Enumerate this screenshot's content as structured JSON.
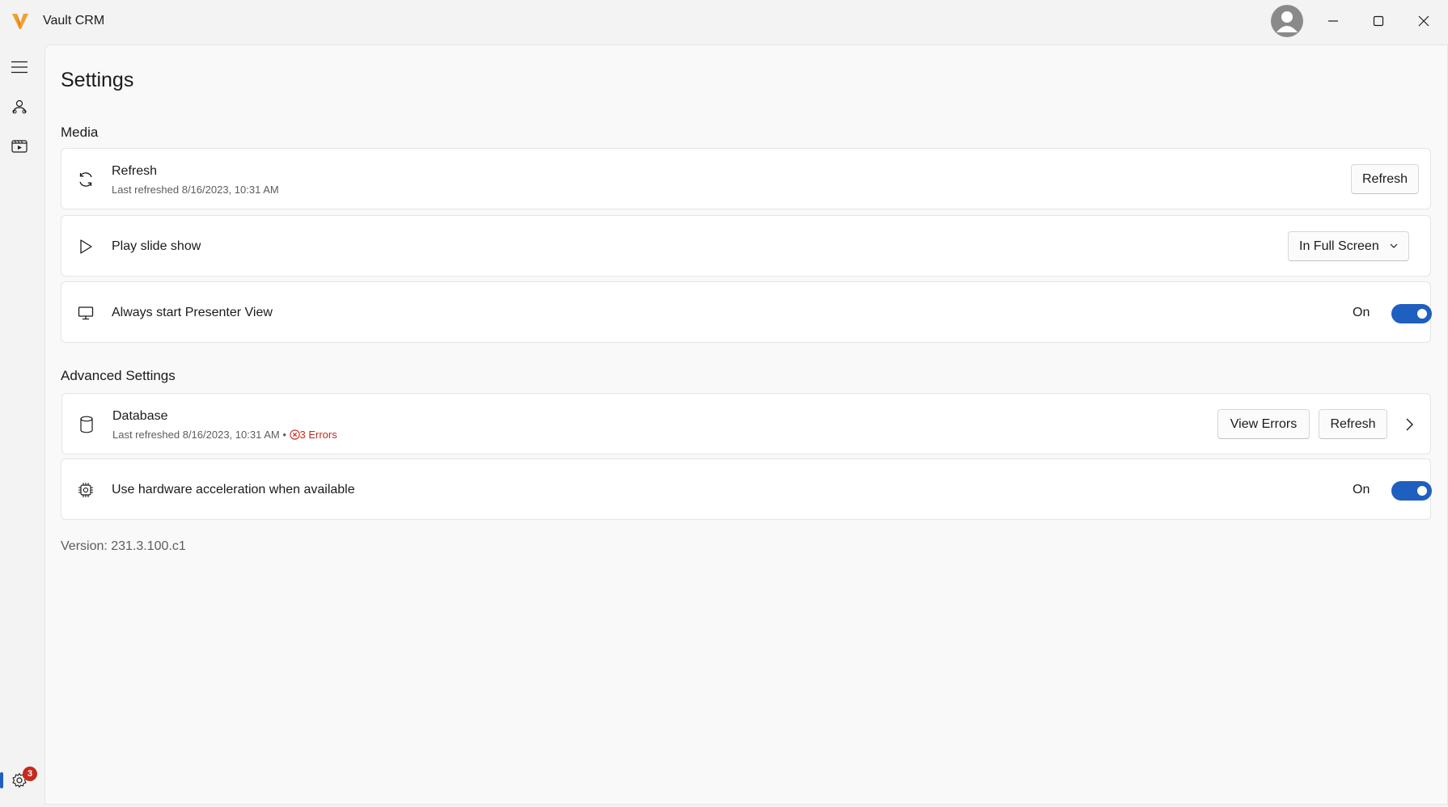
{
  "app": {
    "title": "Vault CRM",
    "brand_color": "#f0a030",
    "accent_color": "#1f5fbf",
    "error_color": "#c42b1c"
  },
  "nav": {
    "items": [
      {
        "name": "menu",
        "icon": "hamburger-icon"
      },
      {
        "name": "accounts",
        "icon": "accounts-icon"
      },
      {
        "name": "media",
        "icon": "media-icon"
      },
      {
        "name": "settings",
        "icon": "gear-icon",
        "active": true
      }
    ],
    "settings_badge": "3"
  },
  "page": {
    "title": "Settings"
  },
  "media": {
    "section_title": "Media",
    "refresh": {
      "title": "Refresh",
      "subtitle": "Last refreshed 8/16/2023, 10:31 AM",
      "button": "Refresh",
      "icon": "sync-icon"
    },
    "slideshow": {
      "title": "Play slide show",
      "selected": "In Full Screen",
      "icon": "play-icon"
    },
    "presenter": {
      "title": "Always start Presenter View",
      "state": "On",
      "icon": "monitor-icon"
    }
  },
  "advanced": {
    "section_title": "Advanced Settings",
    "database": {
      "title": "Database",
      "subtitle": "Last refreshed 8/16/2023, 10:31 AM",
      "separator": "•",
      "errors": "3 Errors",
      "view_errors_button": "View Errors",
      "refresh_button": "Refresh",
      "icon": "database-icon"
    },
    "hardware": {
      "title": "Use hardware acceleration when available",
      "state": "On",
      "icon": "chip-icon"
    }
  },
  "version": "Version: 231.3.100.c1"
}
